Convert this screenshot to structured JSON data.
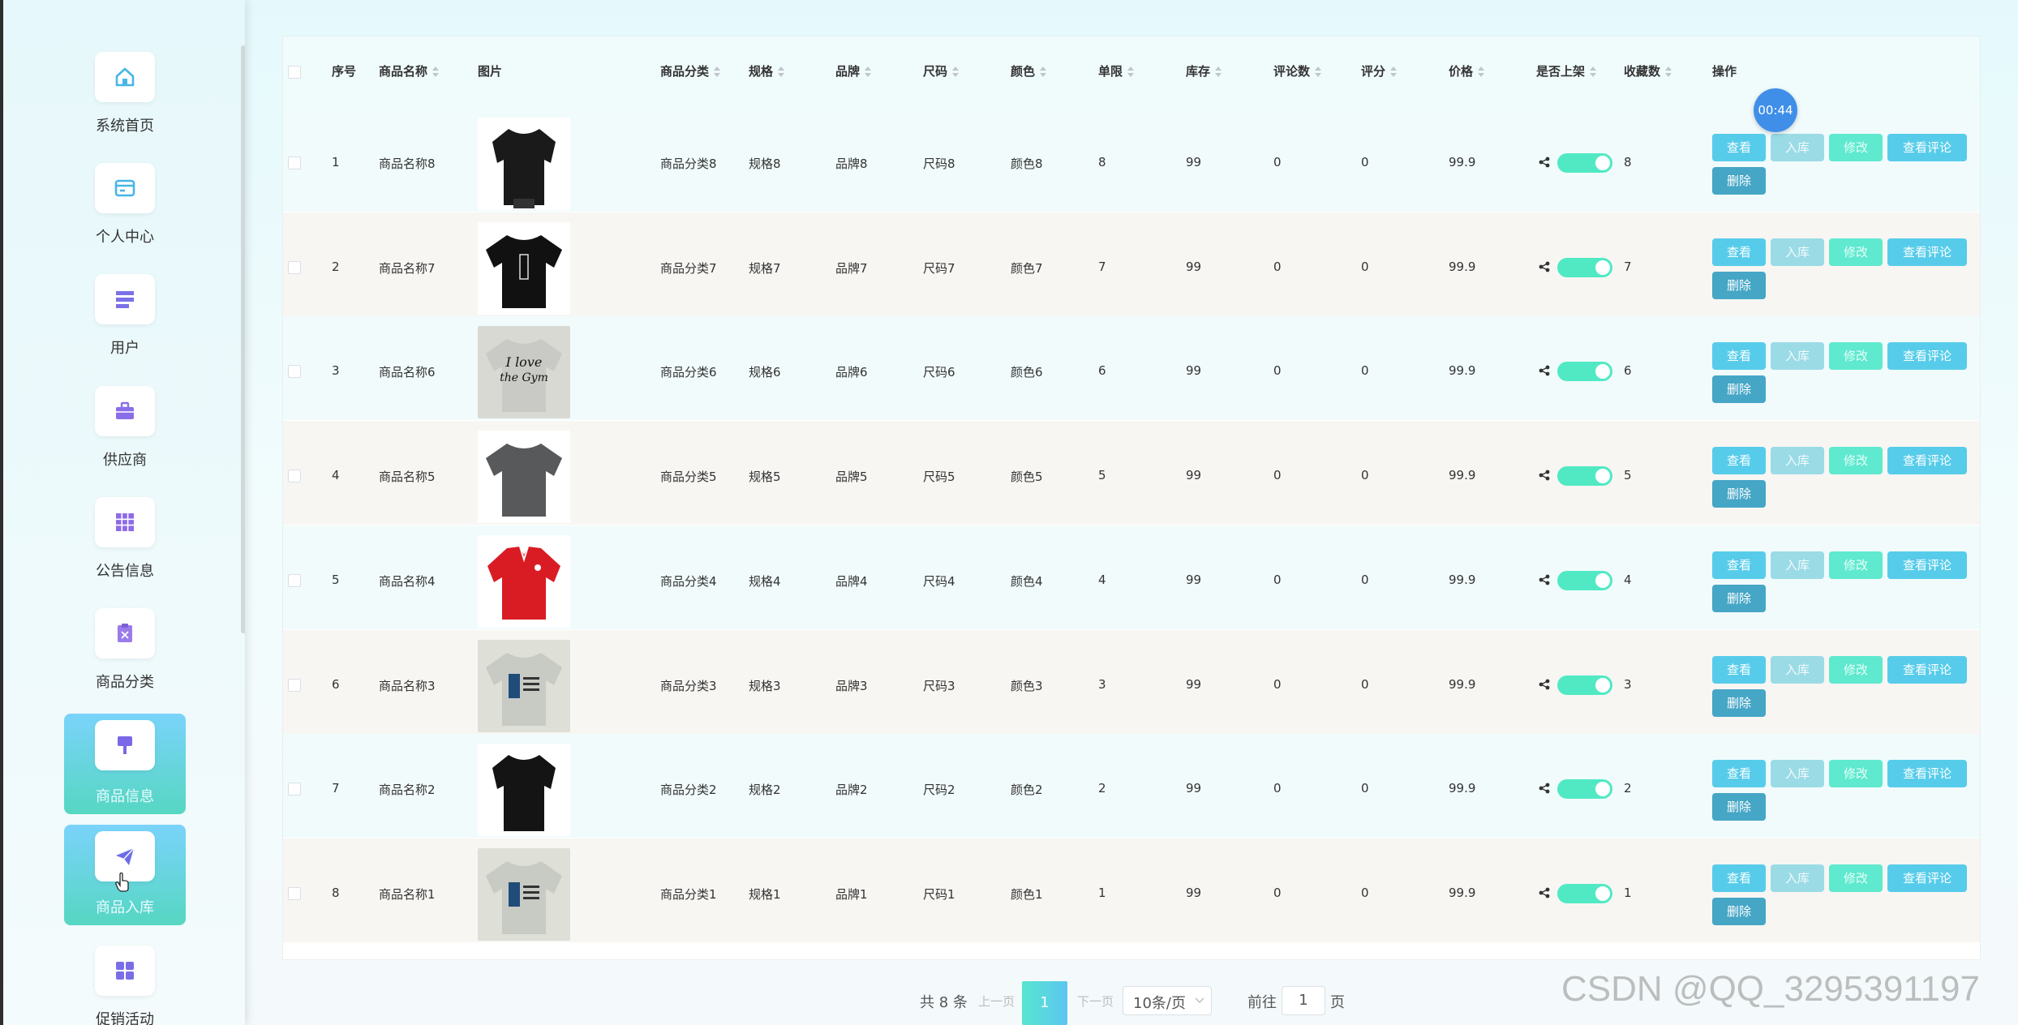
{
  "sidebar": {
    "items": [
      {
        "label": "系统首页",
        "icon": "home-icon",
        "active": false
      },
      {
        "label": "个人中心",
        "icon": "card-icon",
        "active": false
      },
      {
        "label": "用户",
        "icon": "user-list-icon",
        "active": false
      },
      {
        "label": "供应商",
        "icon": "briefcase-icon",
        "active": false
      },
      {
        "label": "公告信息",
        "icon": "grid-icon",
        "active": false
      },
      {
        "label": "商品分类",
        "icon": "clipboard-icon",
        "active": false
      },
      {
        "label": "商品信息",
        "icon": "brush-icon",
        "active": true
      },
      {
        "label": "商品入库",
        "icon": "paper-plane-icon",
        "active": true
      },
      {
        "label": "促销活动",
        "icon": "apps-icon",
        "active": false
      }
    ]
  },
  "table": {
    "headers": [
      "序号",
      "商品名称",
      "图片",
      "商品分类",
      "规格",
      "品牌",
      "尺码",
      "颜色",
      "单限",
      "库存",
      "评论数",
      "评分",
      "价格",
      "是否上架",
      "收藏数",
      "操作"
    ],
    "actions": {
      "view": "查看",
      "stock_in": "入库",
      "edit": "修改",
      "view_reviews": "查看评论",
      "delete": "删除"
    },
    "rows": [
      {
        "idx": "1",
        "name": "商品名称8",
        "image": "black-women-tshirt",
        "category": "商品分类8",
        "spec": "规格8",
        "brand": "品牌8",
        "size": "尺码8",
        "color": "颜色8",
        "limit": "8",
        "stock": "99",
        "reviews": "0",
        "rating": "0",
        "price": "99.9",
        "on_shelf": true,
        "favorites": "8"
      },
      {
        "idx": "2",
        "name": "商品名称7",
        "image": "black-tshirt-print",
        "category": "商品分类7",
        "spec": "规格7",
        "brand": "品牌7",
        "size": "尺码7",
        "color": "颜色7",
        "limit": "7",
        "stock": "99",
        "reviews": "0",
        "rating": "0",
        "price": "99.9",
        "on_shelf": true,
        "favorites": "7"
      },
      {
        "idx": "3",
        "name": "商品名称6",
        "image": "grey-tshirt-i-love-gym",
        "category": "商品分类6",
        "spec": "规格6",
        "brand": "品牌6",
        "size": "尺码6",
        "color": "颜色6",
        "limit": "6",
        "stock": "99",
        "reviews": "0",
        "rating": "0",
        "price": "99.9",
        "on_shelf": true,
        "favorites": "6"
      },
      {
        "idx": "4",
        "name": "商品名称5",
        "image": "dark-grey-tshirt",
        "category": "商品分类5",
        "spec": "规格5",
        "brand": "品牌5",
        "size": "尺码5",
        "color": "颜色5",
        "limit": "5",
        "stock": "99",
        "reviews": "0",
        "rating": "0",
        "price": "99.9",
        "on_shelf": true,
        "favorites": "5"
      },
      {
        "idx": "5",
        "name": "商品名称4",
        "image": "red-polo",
        "category": "商品分类4",
        "spec": "规格4",
        "brand": "品牌4",
        "size": "尺码4",
        "color": "颜色4",
        "limit": "4",
        "stock": "99",
        "reviews": "0",
        "rating": "0",
        "price": "99.9",
        "on_shelf": true,
        "favorites": "4"
      },
      {
        "idx": "6",
        "name": "商品名称3",
        "image": "grey-tshirt-tardis",
        "category": "商品分类3",
        "spec": "规格3",
        "brand": "品牌3",
        "size": "尺码3",
        "color": "颜色3",
        "limit": "3",
        "stock": "99",
        "reviews": "0",
        "rating": "0",
        "price": "99.9",
        "on_shelf": true,
        "favorites": "3"
      },
      {
        "idx": "7",
        "name": "商品名称2",
        "image": "black-women-tee",
        "category": "商品分类2",
        "spec": "规格2",
        "brand": "品牌2",
        "size": "尺码2",
        "color": "颜色2",
        "limit": "2",
        "stock": "99",
        "reviews": "0",
        "rating": "0",
        "price": "99.9",
        "on_shelf": true,
        "favorites": "2"
      },
      {
        "idx": "8",
        "name": "商品名称1",
        "image": "grey-tshirt-tardis",
        "category": "商品分类1",
        "spec": "规格1",
        "brand": "品牌1",
        "size": "尺码1",
        "color": "颜色1",
        "limit": "1",
        "stock": "99",
        "reviews": "0",
        "rating": "0",
        "price": "99.9",
        "on_shelf": true,
        "favorites": "1"
      }
    ]
  },
  "timer": "00:44",
  "pagination": {
    "total": "共 8 条",
    "prev": "上一页",
    "current": "1",
    "next": "下一页",
    "page_size": "10条/页",
    "goto_label": "前往",
    "goto_value": "1",
    "page_suffix": "页"
  },
  "watermark": "CSDN @QQ_3295391197",
  "colors": {
    "accent": "#57ccea",
    "switch_on": "#50e9c3",
    "active_nav": "#7ad3fb"
  }
}
